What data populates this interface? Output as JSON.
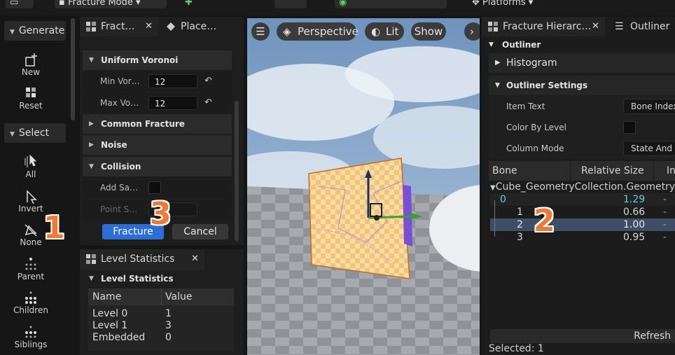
{
  "topbar": {
    "mode_label": "Fracture Mode",
    "platforms_label": "Platforms"
  },
  "modebar": {
    "generate_label": "Generate",
    "select_label": "Select",
    "tools_generate": [
      {
        "label": "New",
        "icon": "new-icon"
      },
      {
        "label": "Reset",
        "icon": "reset-icon"
      }
    ],
    "tools_select": [
      {
        "label": "All",
        "icon": "select-all-icon"
      },
      {
        "label": "Invert",
        "icon": "invert-icon"
      },
      {
        "label": "None",
        "icon": "select-none-icon"
      },
      {
        "label": "Parent",
        "icon": "parent-icon"
      },
      {
        "label": "Children",
        "icon": "children-icon"
      },
      {
        "label": "Siblings",
        "icon": "siblings-icon"
      }
    ]
  },
  "fracture_panel": {
    "tab_fracture": "Fract…",
    "tab_place": "Place…",
    "cat_voronoi": "Uniform Voronoi",
    "min_label": "Min Vor…",
    "min_value": "12",
    "max_label": "Max Vo…",
    "max_value": "12",
    "cat_common": "Common Fracture",
    "cat_noise": "Noise",
    "cat_collision": "Collision",
    "add_sample_label": "Add Sa…",
    "point_s_label": "Point S…",
    "fracture_btn": "Fracture",
    "cancel_btn": "Cancel"
  },
  "level_stats": {
    "tab": "Level Statistics",
    "cat": "Level Statistics",
    "col_name": "Name",
    "col_value": "Value",
    "rows": [
      {
        "name": "Level 0",
        "value": "1"
      },
      {
        "name": "Level 1",
        "value": "3"
      },
      {
        "name": "Embedded",
        "value": "0"
      }
    ]
  },
  "viewport": {
    "perspective": "Perspective",
    "lit": "Lit",
    "show": "Show"
  },
  "hierarchy": {
    "tab_hier": "Fracture Hierarc…",
    "tab_outliner": "Outliner",
    "cat_outliner": "Outliner",
    "histogram": "Histogram",
    "cat_settings": "Outliner Settings",
    "item_text_label": "Item Text",
    "item_text_value": "Bone Index",
    "color_by_level_label": "Color By Level",
    "column_mode_label": "Column Mode",
    "column_mode_value": "State And S",
    "col_bone": "Bone",
    "col_size": "Relative Size",
    "col_in": "In",
    "root": "Cube_GeometryCollection.GeometryC",
    "bones": [
      {
        "name": "0",
        "size": "1.29",
        "i": "-"
      },
      {
        "name": "1",
        "size": "0.66",
        "i": "-"
      },
      {
        "name": "2",
        "size": "1.00",
        "i": "-"
      },
      {
        "name": "3",
        "size": "0.95",
        "i": "-"
      }
    ],
    "refresh": "Refresh",
    "selected": "Selected: 1"
  },
  "annotations": {
    "a1": "1",
    "a2": "2",
    "a3": "3"
  },
  "colors": {
    "accent": "#2b6fd6",
    "annotation": "#f07a35",
    "selected_row": "#3e4e66",
    "root_text": "#5fd3e0"
  }
}
